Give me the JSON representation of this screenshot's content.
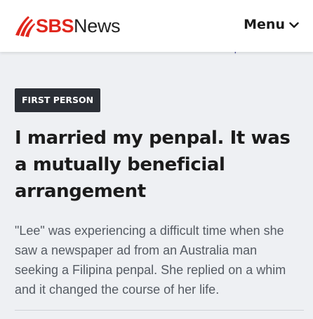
{
  "header": {
    "logo": {
      "brand": "SBS",
      "section": "News"
    },
    "menu_label": "Menu",
    "menu_icon": "chevron-down-icon"
  },
  "article": {
    "category": "FIRST PERSON",
    "title": "I married my penpal. It was a mutually beneficial arrangement",
    "summary": "\"Lee\" was experiencing a difficult time when she saw a newspaper ad from an Australia man seeking a Filipina penpal. She replied on a whim and it changed the course of her life."
  },
  "colors": {
    "brand_red": "#e0261c",
    "badge_bg": "#2b2f36",
    "page_bg": "#eef0f3"
  }
}
